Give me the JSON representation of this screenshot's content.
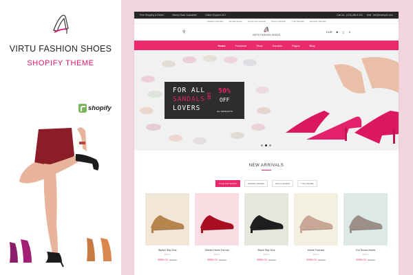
{
  "promo": {
    "title": "VIRTU FASHION SHOES",
    "subtitle": "SHOPIFY THEME",
    "platform_logo_text": "shopify",
    "logo_icon": "high-heel-icon",
    "accent_color": "#e0116b",
    "platform_color": "#7ab55c"
  },
  "site": {
    "topbar": {
      "left": [
        "Free Shipping & Return",
        "Money Back Guarantee",
        "Online Support 24/7"
      ],
      "right": [
        "Call Us : (123) 456 8 000",
        "Mail : info@example.com"
      ]
    },
    "subbar": [
      "Gladiator Sandals",
      "Sandals Heels",
      "Sports and Sandals",
      "Source Sandals",
      "T-bar Sandals",
      "Remarks Sandals"
    ],
    "logo_text": "VIRTU FASHION SHOES",
    "header_right": [
      "EUR",
      "0"
    ],
    "nav": [
      {
        "label": "Home",
        "active": true
      },
      {
        "label": "Footwear",
        "active": false
      },
      {
        "label": "Shop",
        "active": false
      },
      {
        "label": "Sandals",
        "active": false
      },
      {
        "label": "Pages",
        "active": false
      },
      {
        "label": "Blog",
        "active": false
      }
    ],
    "nav_color": "#ea2a6a",
    "hero": {
      "line1": "FOR ALL",
      "line2": "SANDALS",
      "line3": "LOVERS",
      "get": "GET",
      "percent": "50%",
      "off": "OFF",
      "all_products": "ALL PRODUCTS",
      "slides": 3,
      "active_slide": 2
    },
    "arrivals": {
      "title": "NEW ARRIVALS",
      "tabs": [
        {
          "label": "Pump And Sandals",
          "active": true
        },
        {
          "label": "Gladiator Sandals",
          "active": false
        },
        {
          "label": "Source Sandals",
          "active": false
        },
        {
          "label": "T-bar Sandals",
          "active": false
        }
      ],
      "products": [
        {
          "name": "Stylish Slip-Ons",
          "vendor": "Brand",
          "price": "€500.00",
          "old_price": "€600.00",
          "bg": "#f2e7d6",
          "shoe": "#b8844e"
        },
        {
          "name": "Stiletto Heels Formal",
          "vendor": "Brand",
          "price": "€590.00",
          "old_price": "€640.00",
          "bg": "#f9dde3",
          "shoe": "#a80e1f"
        },
        {
          "name": "Black Slip-Ons",
          "vendor": "Brand",
          "price": "€590.00",
          "old_price": "€640.00",
          "bg": "#e7e6dd",
          "shoe": "#1e1e1e"
        },
        {
          "name": "Heels Formals",
          "vendor": "Brand",
          "price": "€330.00",
          "old_price": "€350.00",
          "bg": "#f3f0df",
          "shoe": "#c8a797"
        },
        {
          "name": "Cut Shoes Heels",
          "vendor": "Brand",
          "price": "€330.00",
          "old_price": "€350.00",
          "bg": "#dde9e6",
          "shoe": "#9c8f88"
        }
      ]
    }
  }
}
